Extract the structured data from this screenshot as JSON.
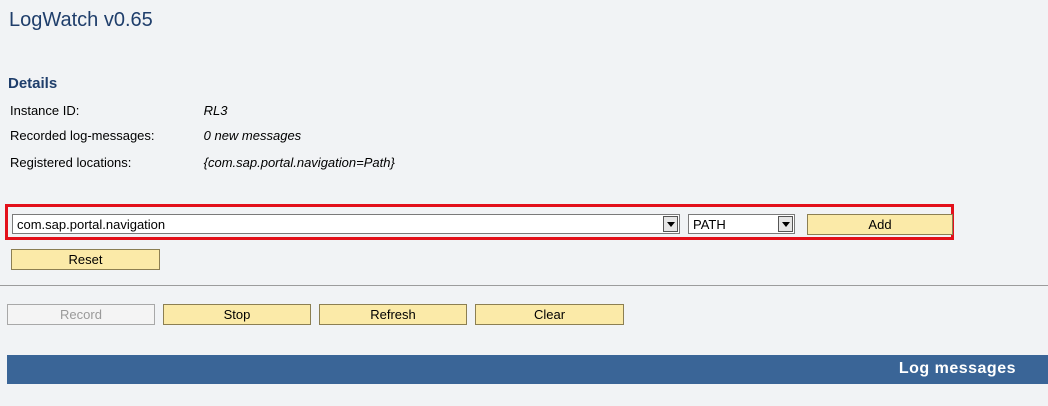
{
  "app": {
    "title": "LogWatch v0.65"
  },
  "details": {
    "heading": "Details",
    "instance_id": {
      "label": "Instance ID:",
      "value": "RL3"
    },
    "recorded": {
      "label": "Recorded log-messages:",
      "value": "0 new messages"
    },
    "locations": {
      "label": "Registered locations:",
      "value": "{com.sap.portal.navigation=Path}"
    }
  },
  "controls": {
    "location_select": "com.sap.portal.navigation",
    "level_select": "PATH",
    "add_label": "Add",
    "reset_label": "Reset"
  },
  "actions": {
    "record_label": "Record",
    "stop_label": "Stop",
    "refresh_label": "Refresh",
    "clear_label": "Clear"
  },
  "log": {
    "heading": "Log messages"
  },
  "colors": {
    "title": "#1f3e6b",
    "button_bg": "#fbeaa8",
    "highlight": "#e3101a",
    "header_bar": "#3a6597"
  }
}
